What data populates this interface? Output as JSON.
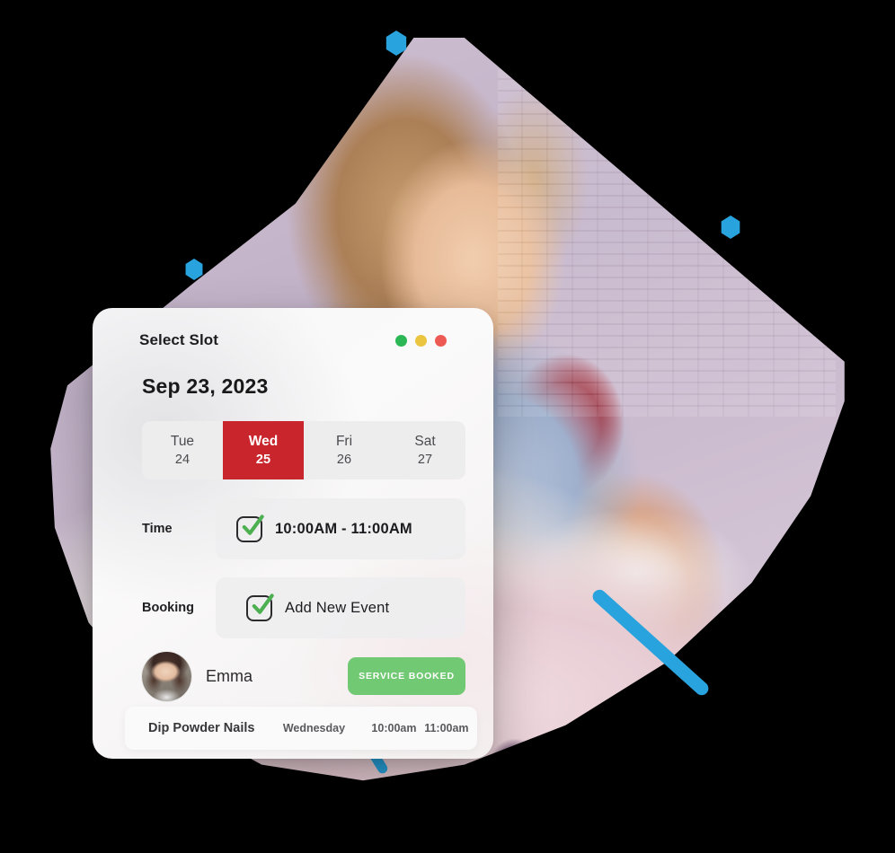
{
  "card": {
    "title": "Select Slot",
    "date": "Sep 23, 2023",
    "window_dots": [
      {
        "name": "green",
        "color": "#2cb757"
      },
      {
        "name": "yellow",
        "color": "#ebc53f"
      },
      {
        "name": "red",
        "color": "#ed5a53"
      }
    ],
    "days": [
      {
        "dow": "Tue",
        "dnum": "24",
        "selected": false
      },
      {
        "dow": "Wed",
        "dnum": "25",
        "selected": true
      },
      {
        "dow": "Fri",
        "dnum": "26",
        "selected": false
      },
      {
        "dow": "Sat",
        "dnum": "27",
        "selected": false
      }
    ],
    "time_row": {
      "label": "Time",
      "value": "10:00AM - 11:00AM",
      "checked": true
    },
    "booking_row": {
      "label": "Booking",
      "value": "Add New Event",
      "checked": true
    },
    "person": {
      "name": "Emma",
      "button_label": "SERVICE BOOKED"
    },
    "appointment": {
      "service": "Dip Powder Nails",
      "day": "Wednesday",
      "start": "10:00am",
      "end": "11:00am"
    }
  },
  "colors": {
    "selected_day_bg": "#c8252c",
    "accent_blue": "#29a3dd",
    "button_green": "#72c973"
  }
}
